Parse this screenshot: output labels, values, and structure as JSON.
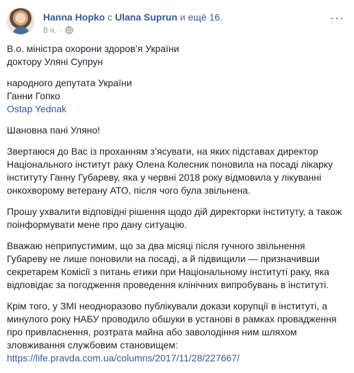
{
  "post": {
    "author": "Hanna Hopko",
    "with_text": " с ",
    "tagged": "Ulana Suprun",
    "and_text": " и ",
    "more": "ещё 16",
    "period": ".",
    "time": "8 ч.",
    "dot": "·",
    "menu_icon": "···",
    "address": [
      "В.о. міністра охорони здоров’я України",
      "доктору Уляні Супрун"
    ],
    "sender": [
      "народного депутата України",
      "Ганни Гопко"
    ],
    "mention": "Ostap Yednak",
    "greeting": "Шановна пані Уляно!",
    "p1": [
      "Звертаюся до Вас із проханням з’ясувати, на яких підставах директор",
      "Національного інститут раку Олена Колесник поновила на посаді лікарку",
      "інституту Ганну Губареву, яка у червні 2018 року відмовила у лікуванні",
      "онкохворому ветерану АТО, після чого була звільнена."
    ],
    "p2": [
      "Прошу ухвалити відповідні рішення щодо дій директорки інституту, а також",
      "поінформувати мене про дану ситуацію."
    ],
    "p3": [
      "Вважаю неприпустимим, що за два місяці після гучного звільнення",
      "Губареву не лише поновили на посаді, а й підвищили — призначивши",
      "секретарем Комісії з питань етики при Національному інституті раку, яка",
      "відповідає за погодження проведення клінічних випробувань в інституті."
    ],
    "p4": [
      "Крім того, у ЗМІ неодноразово публікували докази корупції в інституті, а",
      "минулого року НАБУ проводило обшуки в установі в рамках провадження",
      "про привласнення, розтрата майна або заволодіння ним шляхом",
      "зловживання службовим становищем:"
    ],
    "link": "https://life.pravda.com.ua/columns/2017/11/28/227667/"
  }
}
